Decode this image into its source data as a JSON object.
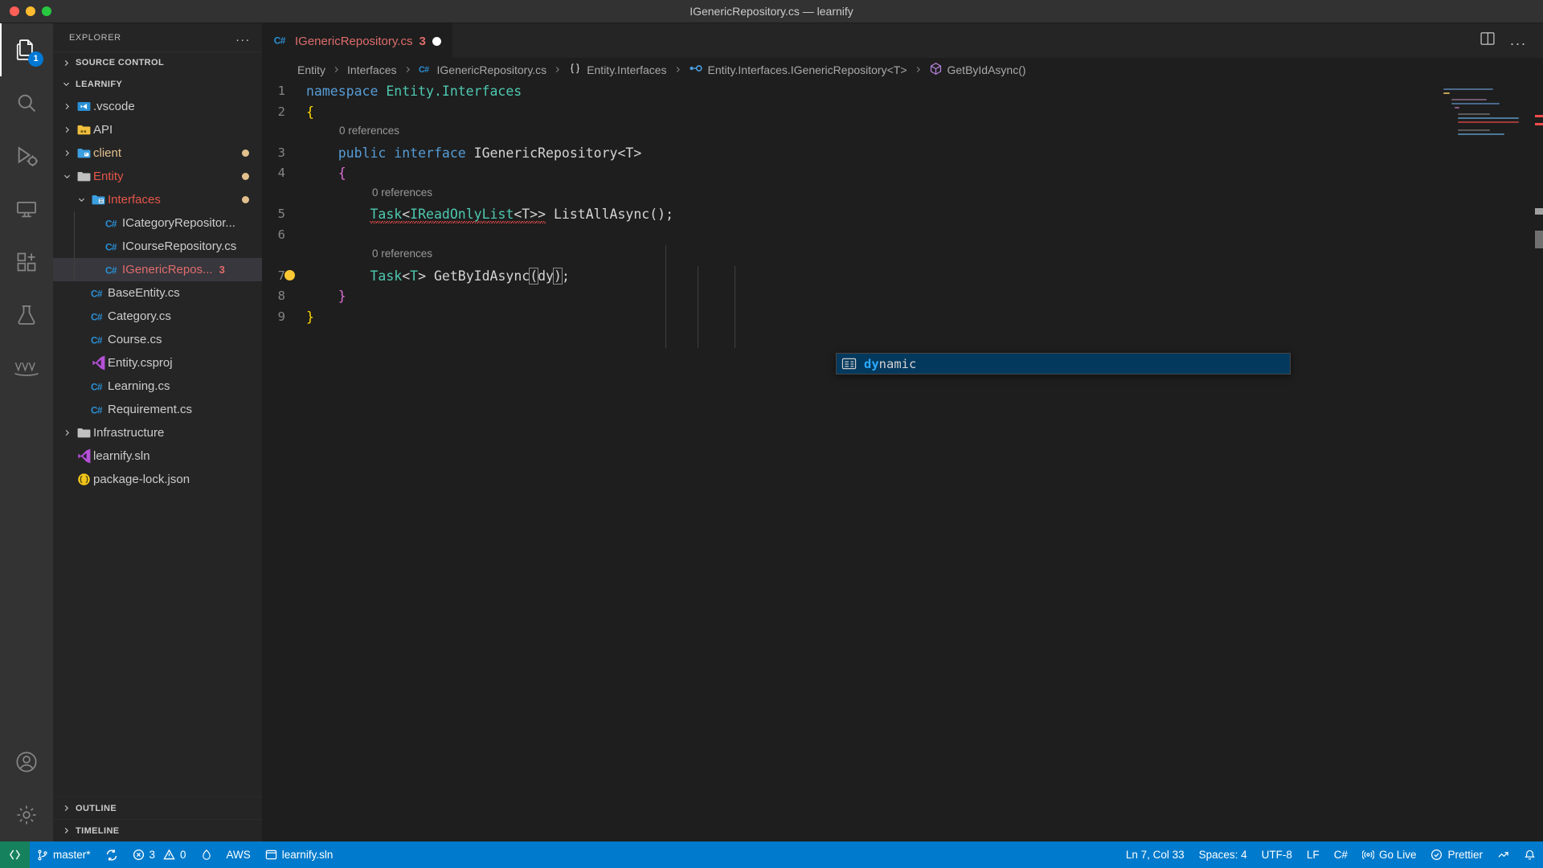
{
  "window": {
    "title": "IGenericRepository.cs — learnify",
    "traffic_lights": [
      "close",
      "minimize",
      "zoom"
    ]
  },
  "activity_bar": {
    "items": [
      {
        "name": "explorer",
        "icon": "files-icon",
        "badge": "1",
        "active": true
      },
      {
        "name": "search",
        "icon": "search-icon",
        "badge": "",
        "active": false
      },
      {
        "name": "run-and-debug",
        "icon": "debug-icon",
        "badge": "",
        "active": false
      },
      {
        "name": "remote-explorer",
        "icon": "remote-icon",
        "badge": "",
        "active": false
      },
      {
        "name": "extensions",
        "icon": "extensions-icon",
        "badge": "",
        "active": false
      },
      {
        "name": "test-explorer",
        "icon": "beaker-icon",
        "badge": "",
        "active": false
      },
      {
        "name": "aws-toolkit",
        "icon": "aws-icon",
        "badge": "",
        "active": false
      }
    ],
    "bottom_items": [
      {
        "name": "accounts",
        "icon": "account-icon"
      },
      {
        "name": "manage-settings",
        "icon": "gear-icon"
      }
    ]
  },
  "sidebar": {
    "header": {
      "title": "EXPLORER",
      "actions_label": "..."
    },
    "sections": [
      {
        "label": "SOURCE CONTROL",
        "expanded": false
      },
      {
        "label": "LEARNIFY",
        "expanded": true
      }
    ],
    "bottom_sections": [
      {
        "label": "OUTLINE",
        "expanded": false
      },
      {
        "label": "TIMELINE",
        "expanded": false
      }
    ],
    "tree": [
      {
        "label": ".vscode",
        "depth": 1,
        "twisty": "collapsed",
        "icon": "vscode-folder-icon",
        "state": "normal",
        "badge": "",
        "dirty": false
      },
      {
        "label": "API",
        "depth": 1,
        "twisty": "collapsed",
        "icon": "api-folder-icon",
        "state": "normal",
        "badge": "",
        "dirty": false
      },
      {
        "label": "client",
        "depth": 1,
        "twisty": "collapsed",
        "icon": "client-folder-icon",
        "state": "modified",
        "badge": "",
        "dirty": true
      },
      {
        "label": "Entity",
        "depth": 1,
        "twisty": "expanded",
        "icon": "folder-icon",
        "state": "modified-red",
        "badge": "",
        "dirty": true
      },
      {
        "label": "Interfaces",
        "depth": 2,
        "twisty": "expanded",
        "icon": "interface-folder-icon",
        "state": "modified-red",
        "badge": "",
        "dirty": true
      },
      {
        "label": "ICategoryRepositor...",
        "depth": 3,
        "twisty": "none",
        "icon": "csharp-icon",
        "state": "normal",
        "badge": "",
        "dirty": false
      },
      {
        "label": "ICourseRepository.cs",
        "depth": 3,
        "twisty": "none",
        "icon": "csharp-icon",
        "state": "normal",
        "badge": "",
        "dirty": false
      },
      {
        "label": "IGenericRepos...",
        "depth": 3,
        "twisty": "none",
        "icon": "csharp-icon",
        "state": "error-selected",
        "badge": "3",
        "dirty": false
      },
      {
        "label": "BaseEntity.cs",
        "depth": 2,
        "twisty": "none",
        "icon": "csharp-icon",
        "state": "normal",
        "badge": "",
        "dirty": false
      },
      {
        "label": "Category.cs",
        "depth": 2,
        "twisty": "none",
        "icon": "csharp-icon",
        "state": "normal",
        "badge": "",
        "dirty": false
      },
      {
        "label": "Course.cs",
        "depth": 2,
        "twisty": "none",
        "icon": "csharp-icon",
        "state": "normal",
        "badge": "",
        "dirty": false
      },
      {
        "label": "Entity.csproj",
        "depth": 2,
        "twisty": "none",
        "icon": "visualstudio-icon",
        "state": "normal",
        "badge": "",
        "dirty": false
      },
      {
        "label": "Learning.cs",
        "depth": 2,
        "twisty": "none",
        "icon": "csharp-icon",
        "state": "normal",
        "badge": "",
        "dirty": false
      },
      {
        "label": "Requirement.cs",
        "depth": 2,
        "twisty": "none",
        "icon": "csharp-icon",
        "state": "normal",
        "badge": "",
        "dirty": false
      },
      {
        "label": "Infrastructure",
        "depth": 1,
        "twisty": "collapsed",
        "icon": "folder-icon",
        "state": "normal",
        "badge": "",
        "dirty": false
      },
      {
        "label": "learnify.sln",
        "depth": 1,
        "twisty": "none",
        "icon": "visualstudio-icon",
        "state": "normal",
        "badge": "",
        "dirty": false
      },
      {
        "label": "package-lock.json",
        "depth": 1,
        "twisty": "none",
        "icon": "json-icon",
        "state": "normal",
        "badge": "",
        "dirty": false
      }
    ]
  },
  "editor": {
    "tabs": [
      {
        "label": "IGenericRepository.cs",
        "icon": "csharp-icon",
        "error_count": "3",
        "dirty": true,
        "active": true
      }
    ],
    "actions": {
      "split_editor": "split-editor-icon",
      "more_actions": "..."
    },
    "breadcrumbs": [
      {
        "label": "Entity",
        "icon": ""
      },
      {
        "label": "Interfaces",
        "icon": ""
      },
      {
        "label": "IGenericRepository.cs",
        "icon": "csharp-icon"
      },
      {
        "label": "Entity.Interfaces",
        "icon": "namespace-icon"
      },
      {
        "label": "Entity.Interfaces.IGenericRepository<T>",
        "icon": "interface-icon"
      },
      {
        "label": "GetByIdAsync()",
        "icon": "method-icon"
      }
    ],
    "lines": [
      {
        "num": "1",
        "text": "namespace Entity.Interfaces"
      },
      {
        "num": "2",
        "text": "{"
      },
      {
        "num": "3",
        "text": "    public interface IGenericRepository<T>"
      },
      {
        "num": "4",
        "text": "    {"
      },
      {
        "num": "5",
        "text": "        Task<IReadOnlyList<T>> ListAllAsync();"
      },
      {
        "num": "6",
        "text": ""
      },
      {
        "num": "7",
        "text": "        Task<T> GetByIdAsync(dy);"
      },
      {
        "num": "8",
        "text": "    }"
      },
      {
        "num": "9",
        "text": "}"
      }
    ],
    "codelens": [
      {
        "label": "0 references",
        "above_line": "3"
      },
      {
        "label": "0 references",
        "above_line": "5"
      },
      {
        "label": "0 references",
        "above_line": "7"
      }
    ],
    "lightbulb_line": "7"
  },
  "suggest_widget": {
    "items": [
      {
        "label": "dynamic",
        "matched_prefix": "dy",
        "icon": "keyword-icon",
        "selected": true
      }
    ]
  },
  "status_bar": {
    "left": [
      {
        "name": "remote-host",
        "label": "",
        "icon": "remote-indicator-icon"
      },
      {
        "name": "source-control-branch",
        "label": "master*",
        "icon": "git-branch-icon"
      },
      {
        "name": "sync-changes",
        "label": "",
        "icon": "sync-icon"
      },
      {
        "name": "problems",
        "label": "3",
        "label2": "0",
        "icon": "error-icon",
        "icon2": "warning-icon"
      },
      {
        "name": "radon-ignore",
        "label": "",
        "icon": "flame-icon"
      },
      {
        "name": "aws-profile",
        "label": "AWS",
        "icon": ""
      },
      {
        "name": "solution",
        "label": "learnify.sln",
        "icon": "solution-icon"
      }
    ],
    "right": [
      {
        "name": "editor-position",
        "label": "Ln 7, Col 33",
        "icon": ""
      },
      {
        "name": "indentation",
        "label": "Spaces: 4",
        "icon": ""
      },
      {
        "name": "encoding",
        "label": "UTF-8",
        "icon": ""
      },
      {
        "name": "eol",
        "label": "LF",
        "icon": ""
      },
      {
        "name": "language-mode",
        "label": "C#",
        "icon": ""
      },
      {
        "name": "go-live",
        "label": "Go Live",
        "icon": "broadcast-icon"
      },
      {
        "name": "prettier",
        "label": "Prettier",
        "icon": "check-circle-icon"
      },
      {
        "name": "remote-status",
        "label": "",
        "icon": "remote-status-icon"
      },
      {
        "name": "notifications",
        "label": "",
        "icon": "bell-icon"
      }
    ],
    "colors": {
      "background": "#007acc",
      "remote_background": "#16825d",
      "foreground": "#ffffff"
    }
  },
  "colors": {
    "editor_background": "#1e1e1e",
    "sidebar_background": "#252526",
    "activitybar_background": "#333333",
    "titlebar_background": "#323233",
    "accent": "#007acc",
    "error": "#f14c4c",
    "modified": "#e2c08d",
    "selection": "#04395e"
  }
}
